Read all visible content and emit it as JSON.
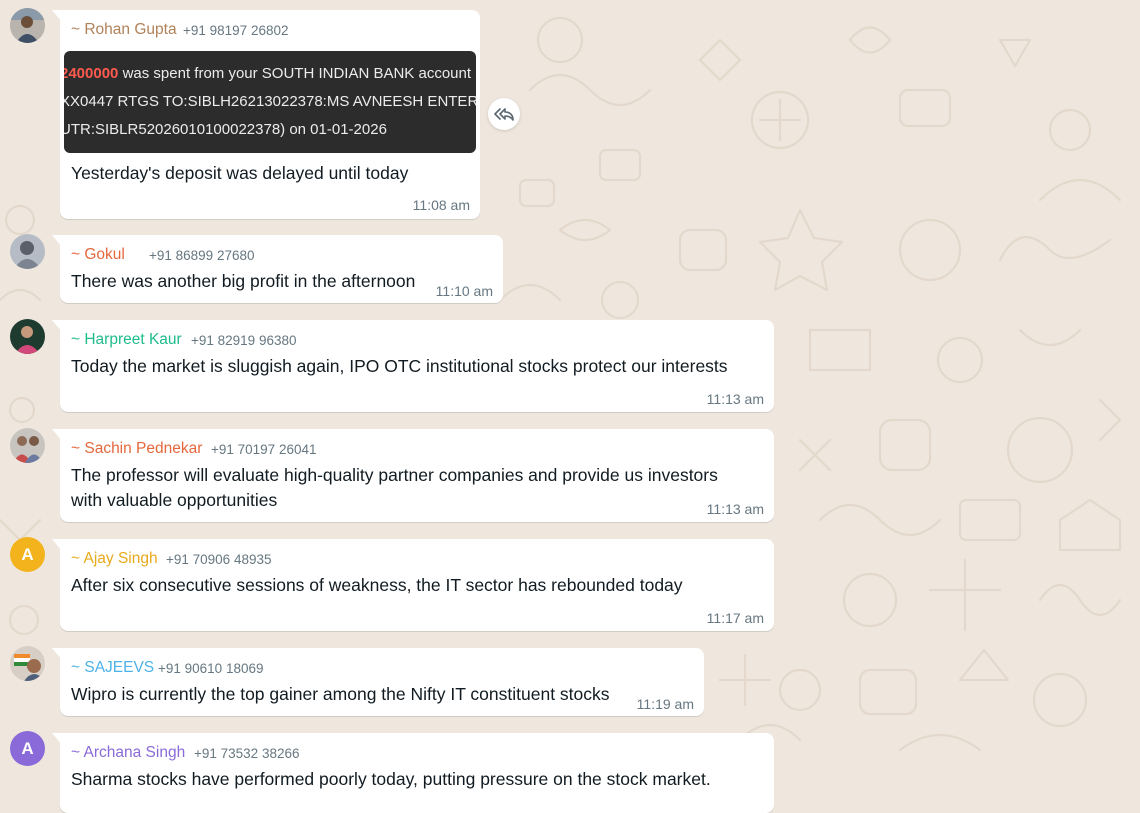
{
  "colors": {
    "background": "#efe7de",
    "bubble": "#ffffff",
    "meta_text": "#667781",
    "message_text": "#111b21",
    "amount_highlight": "#ff5a4e"
  },
  "forward_icon": "forward-icon",
  "messages": [
    {
      "sender": "~ Rohan Gupta",
      "sender_color": "#b0825a",
      "phone": "+91 98197 26802",
      "avatar": "photo",
      "image": {
        "amount": "2400000",
        "line1_rest": " was spent from your SOUTH INDIAN BANK account",
        "line2": "XX0447 RTGS TO:SIBLH26213022378:MS AVNEESH ENTER",
        "line3": "UTR:SIBLR52026010100022378) on 01-01-2026"
      },
      "text": "Yesterday's deposit was delayed until today",
      "time": "11:08 am"
    },
    {
      "sender": "~ Gokul",
      "sender_color": "#e5673b",
      "phone": "+91 86899 27680",
      "avatar": "photo",
      "text": "There was another big profit in the afternoon",
      "time": "11:10 am"
    },
    {
      "sender": "~ Harpreet Kaur",
      "sender_color": "#1fbc8c",
      "phone": "+91 82919 96380",
      "avatar": "photo",
      "text": "Today the market is sluggish again, IPO OTC institutional stocks protect our interests",
      "time": "11:13 am"
    },
    {
      "sender": "~ Sachin Pednekar",
      "sender_color": "#e5673b",
      "phone": "+91 70197 26041",
      "avatar": "photo",
      "text_lines": [
        "The professor will evaluate high-quality partner companies and provide us investors",
        "with valuable opportunities"
      ],
      "time": "11:13 am"
    },
    {
      "sender": "~ Ajay Singh",
      "sender_color": "#e8a91a",
      "phone": "+91 70906 48935",
      "avatar": "A",
      "avatar_color": "#f3b31d",
      "text": "After six consecutive sessions of weakness, the IT sector has rebounded today",
      "time": "11:17 am"
    },
    {
      "sender": "~ SAJEEVS",
      "sender_color": "#4cb3e6",
      "phone": "+91 90610 18069",
      "avatar": "photo",
      "text": "Wipro is currently the top gainer among the Nifty IT constituent stocks",
      "time": "11:19 am"
    },
    {
      "sender": "~ Archana Singh",
      "sender_color": "#8a6ad8",
      "phone": "+91 73532 38266",
      "avatar": "A",
      "avatar_color": "#8a6ad8",
      "text": "Sharma stocks have performed poorly today, putting pressure on the stock market.",
      "time": ""
    }
  ]
}
